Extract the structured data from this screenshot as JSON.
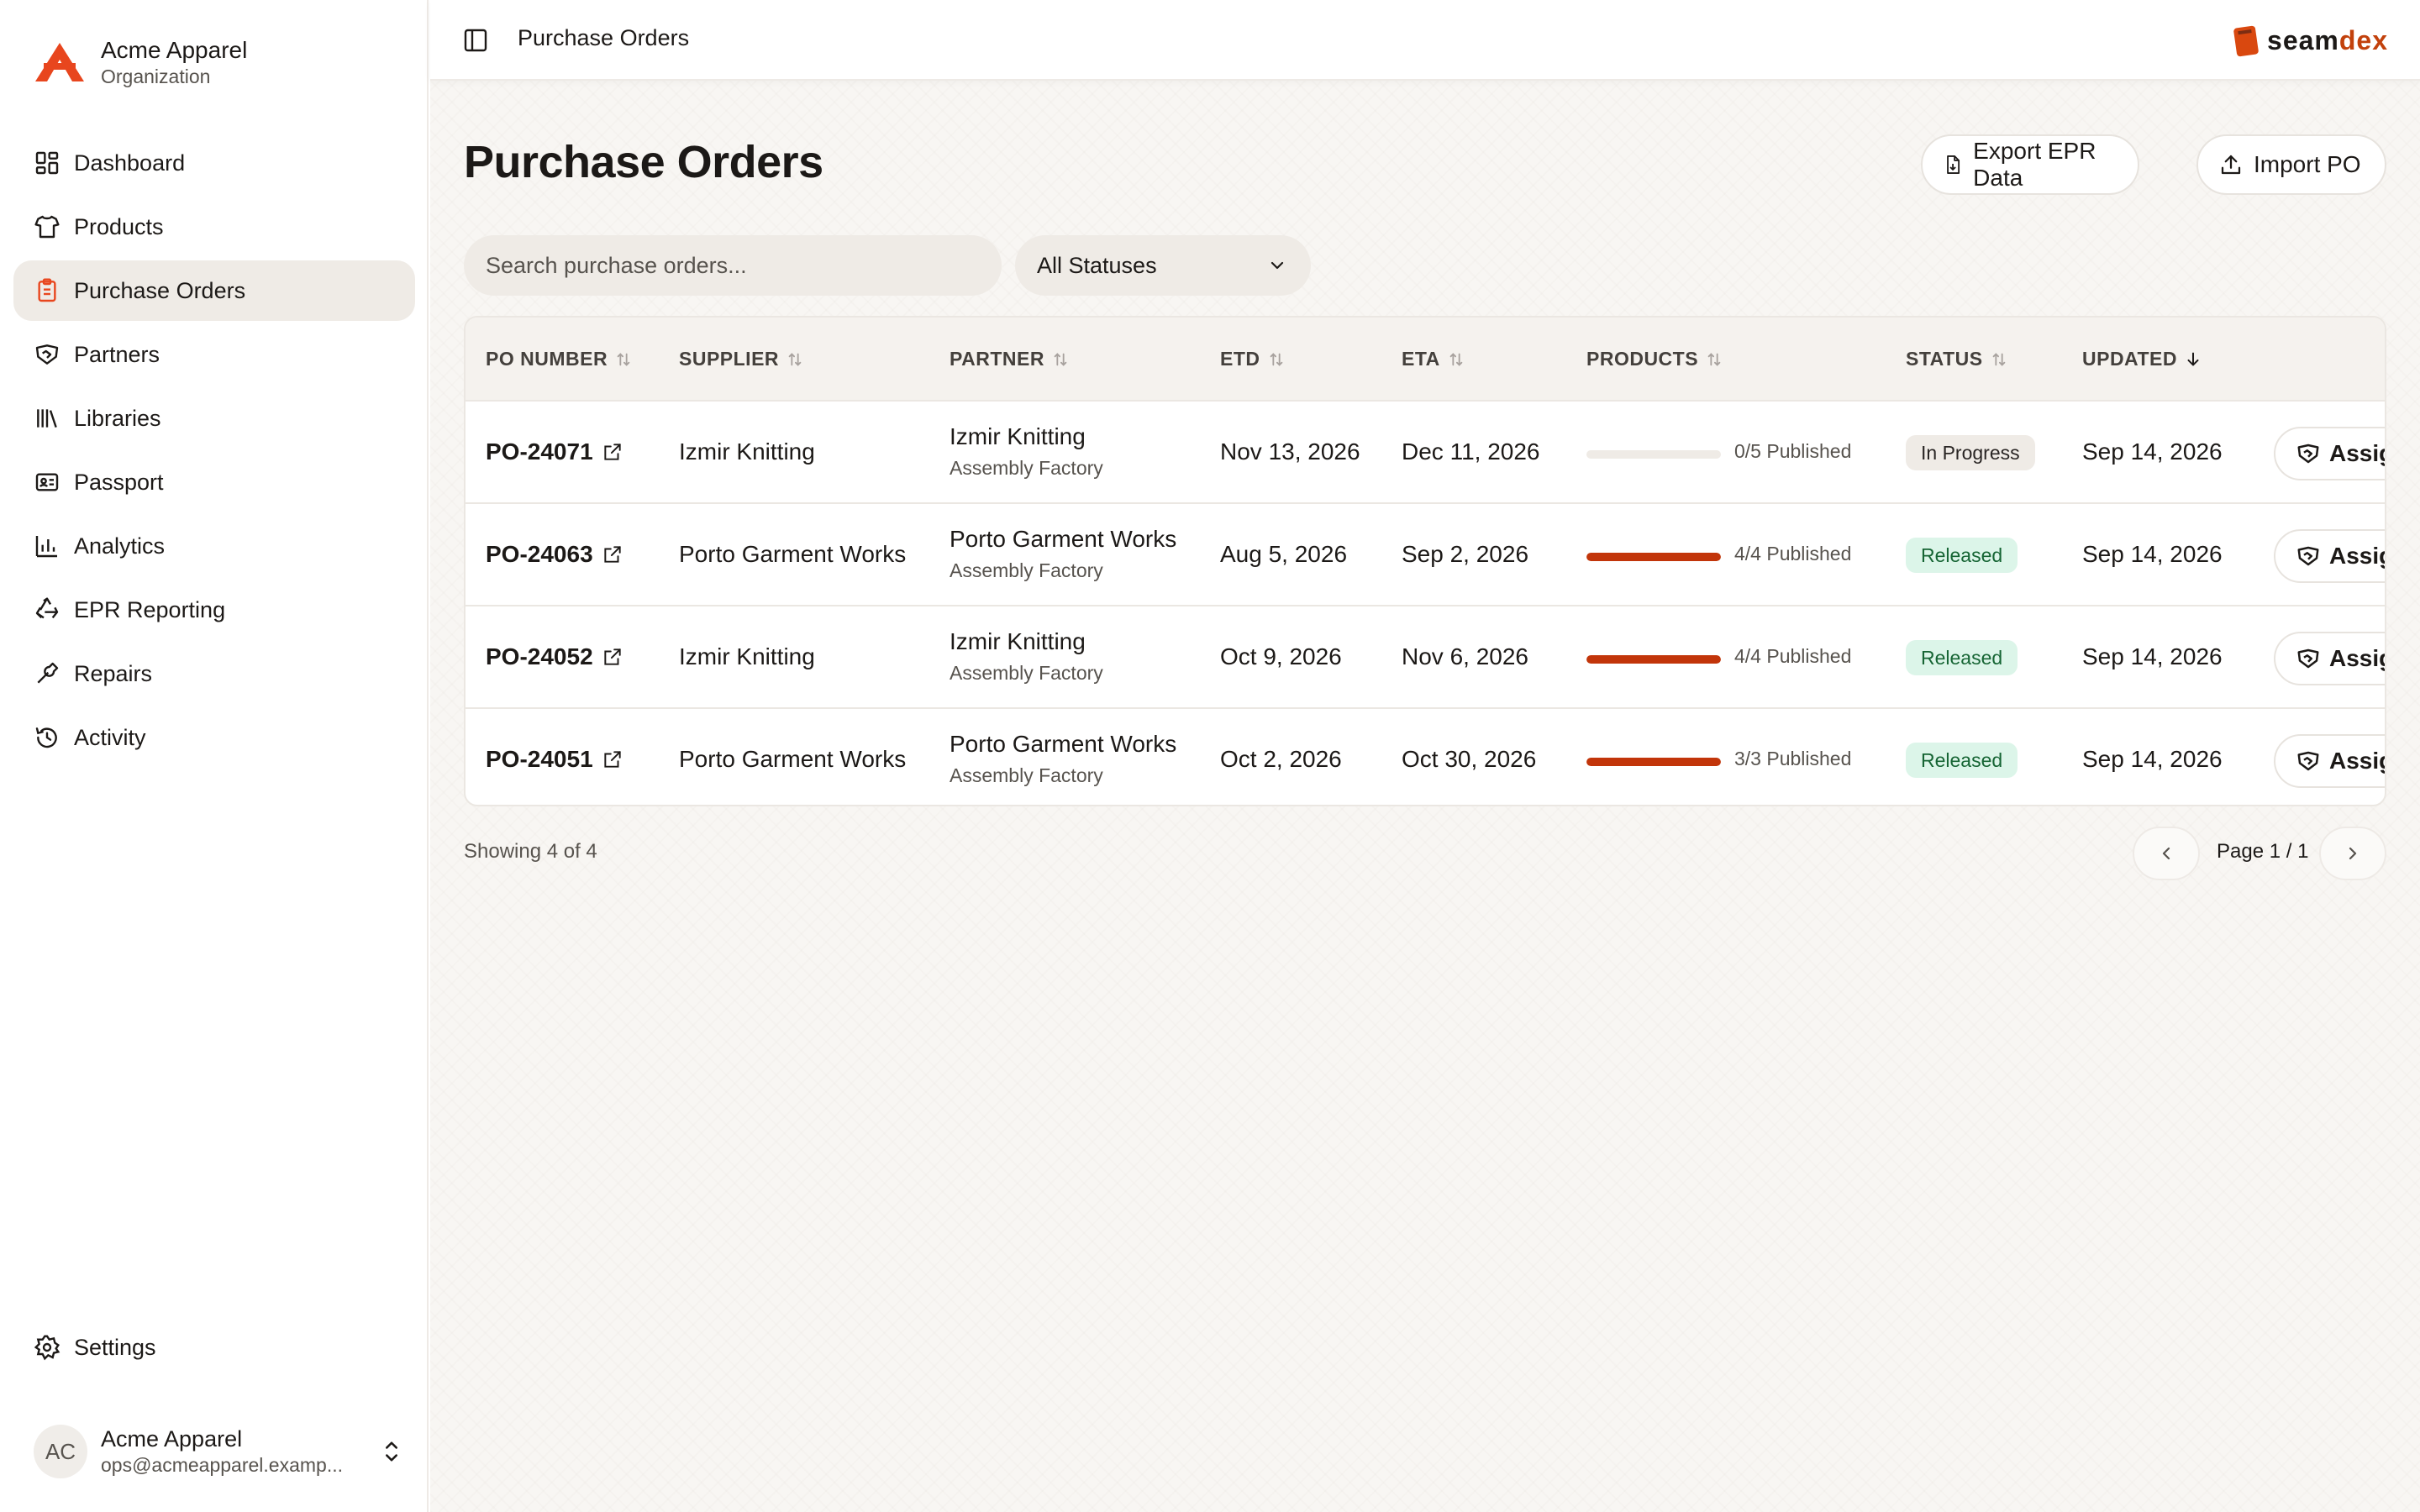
{
  "org": {
    "name": "Acme Apparel",
    "sub": "Organization"
  },
  "nav": {
    "items": [
      {
        "label": "Dashboard",
        "icon": "dashboard-icon"
      },
      {
        "label": "Products",
        "icon": "shirt-icon"
      },
      {
        "label": "Purchase Orders",
        "icon": "clipboard-icon",
        "active": true
      },
      {
        "label": "Partners",
        "icon": "handshake-icon"
      },
      {
        "label": "Libraries",
        "icon": "library-icon"
      },
      {
        "label": "Passport",
        "icon": "id-card-icon"
      },
      {
        "label": "Analytics",
        "icon": "bar-chart-icon"
      },
      {
        "label": "EPR Reporting",
        "icon": "recycle-icon"
      },
      {
        "label": "Repairs",
        "icon": "wrench-icon"
      },
      {
        "label": "Activity",
        "icon": "history-icon"
      }
    ],
    "settings": "Settings"
  },
  "user": {
    "initials": "AC",
    "name": "Acme Apparel",
    "email": "ops@acmeapparel.examp..."
  },
  "topbar": {
    "breadcrumb": "Purchase Orders",
    "brand_a": "seam",
    "brand_b": "dex"
  },
  "page": {
    "title": "Purchase Orders",
    "export_label": "Export EPR Data",
    "import_label": "Import PO",
    "search_placeholder": "Search purchase orders...",
    "status_filter": "All Statuses"
  },
  "table": {
    "columns": [
      "PO NUMBER",
      "SUPPLIER",
      "PARTNER",
      "ETD",
      "ETA",
      "PRODUCTS",
      "STATUS",
      "UPDATED"
    ],
    "rows": [
      {
        "po": "PO-24071",
        "supplier": "Izmir Knitting",
        "partner": "Izmir Knitting",
        "partner_role": "Assembly Factory",
        "etd": "Nov 13, 2026",
        "eta": "Dec 11, 2026",
        "progress": 0.0,
        "published": "0/5 Published",
        "status": "In Progress",
        "updated": "Sep 14, 2026",
        "action": "Assign"
      },
      {
        "po": "PO-24063",
        "supplier": "Porto Garment Works",
        "partner": "Porto Garment Works",
        "partner_role": "Assembly Factory",
        "etd": "Aug 5, 2026",
        "eta": "Sep 2, 2026",
        "progress": 1.0,
        "published": "4/4 Published",
        "status": "Released",
        "updated": "Sep 14, 2026",
        "action": "Assign"
      },
      {
        "po": "PO-24052",
        "supplier": "Izmir Knitting",
        "partner": "Izmir Knitting",
        "partner_role": "Assembly Factory",
        "etd": "Oct 9, 2026",
        "eta": "Nov 6, 2026",
        "progress": 1.0,
        "published": "4/4 Published",
        "status": "Released",
        "updated": "Sep 14, 2026",
        "action": "Assign"
      },
      {
        "po": "PO-24051",
        "supplier": "Porto Garment Works",
        "partner": "Porto Garment Works",
        "partner_role": "Assembly Factory",
        "etd": "Oct 2, 2026",
        "eta": "Oct 30, 2026",
        "progress": 1.0,
        "published": "3/3 Published",
        "status": "Released",
        "updated": "Sep 14, 2026",
        "action": "Assign"
      }
    ]
  },
  "footer": {
    "showing": "Showing 4 of 4",
    "page": "Page 1 / 1"
  },
  "colors": {
    "accent": "#c2350a",
    "released_bg": "#dcf5e9",
    "released_text": "#166534"
  }
}
